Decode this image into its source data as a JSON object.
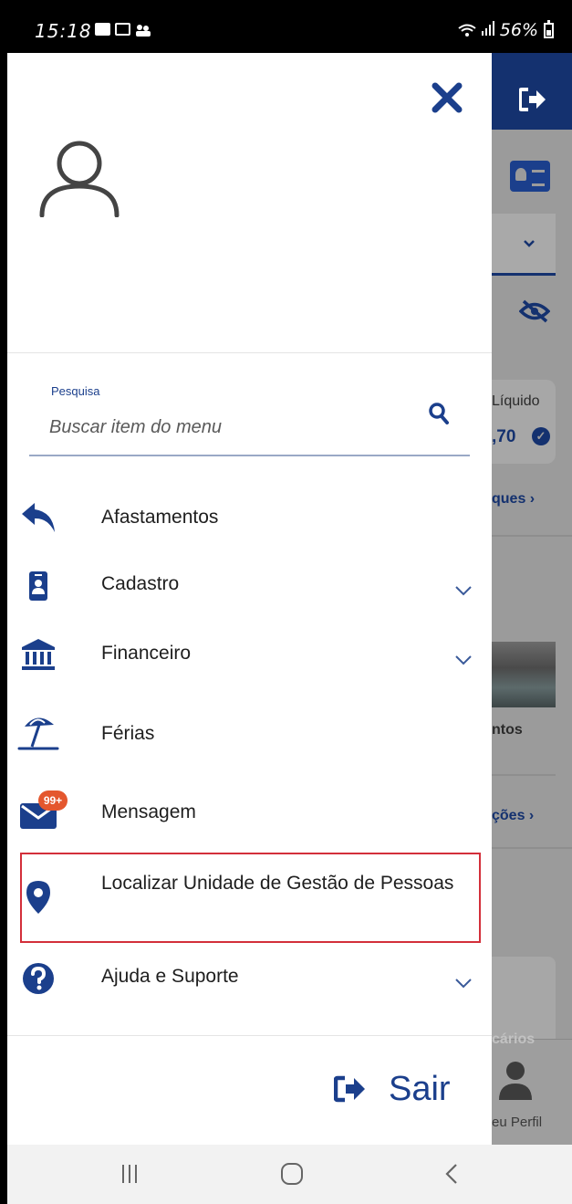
{
  "status_bar": {
    "time": "15:18",
    "battery": "56%",
    "icons": [
      "notification-icon",
      "image-icon",
      "app-icon",
      "wifi-icon",
      "signal-icon",
      "battery-icon"
    ]
  },
  "drawer": {
    "close_icon": "close-icon",
    "avatar_icon": "user-outline-icon",
    "search": {
      "label": "Pesquisa",
      "placeholder": "Buscar item do menu"
    },
    "menu_items": [
      {
        "label": "Afastamentos",
        "icon": "reply-arrow-icon",
        "expandable": false
      },
      {
        "label": "Cadastro",
        "icon": "id-badge-icon",
        "expandable": true
      },
      {
        "label": "Financeiro",
        "icon": "bank-icon",
        "expandable": true
      },
      {
        "label": "Férias",
        "icon": "beach-umbrella-icon",
        "expandable": false
      },
      {
        "label": "Mensagem",
        "icon": "mail-icon",
        "expandable": false,
        "badge": "99+"
      },
      {
        "label": "Localizar Unidade de Gestão de Pessoas",
        "icon": "location-pin-icon",
        "expandable": false,
        "highlighted": true
      },
      {
        "label": "Ajuda e Suporte",
        "icon": "help-circle-icon",
        "expandable": true
      }
    ],
    "logout": {
      "label": "Sair",
      "icon": "logout-icon"
    }
  },
  "background_app": {
    "liquido_label": "Líquido",
    "value_fragment": ",70",
    "link1": "ques",
    "tile_label": "ntos",
    "link2": "ções",
    "card_label": "cários",
    "tab_label": "eu Perfil"
  },
  "colors": {
    "primary": "#1b3f8c",
    "header": "#14316f",
    "highlight_border": "#d32f3a",
    "badge": "#e4572e"
  }
}
